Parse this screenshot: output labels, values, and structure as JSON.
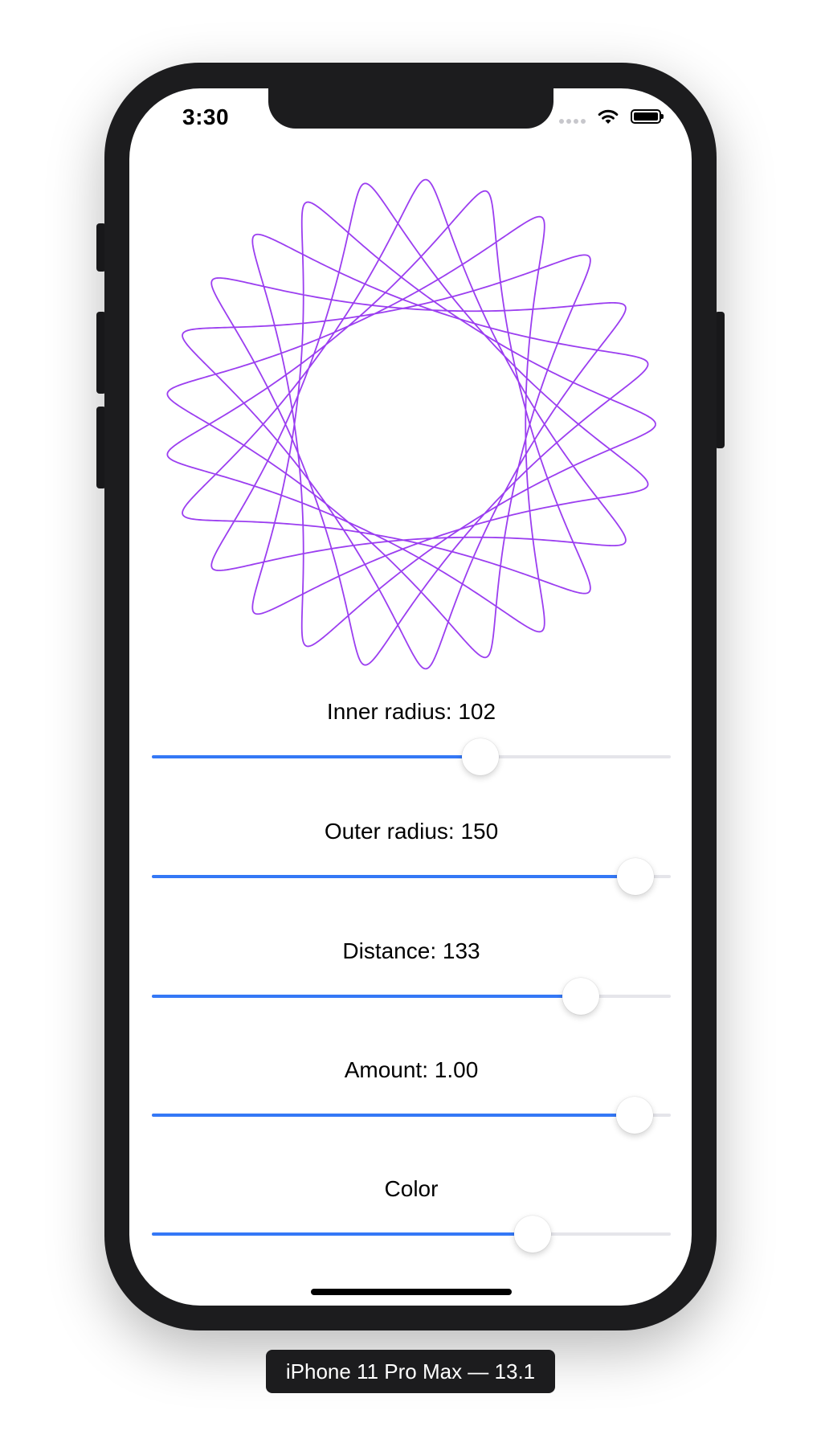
{
  "status_bar": {
    "time": "3:30"
  },
  "spirograph": {
    "inner_radius": 102,
    "outer_radius": 150,
    "distance": 133,
    "stroke_color": "#9b3ef0"
  },
  "controls": [
    {
      "label": "Inner radius: 102",
      "value": 0.643
    },
    {
      "label": "Outer radius: 150",
      "value": 0.965
    },
    {
      "label": "Distance: 133",
      "value": 0.852
    },
    {
      "label": "Amount: 1.00",
      "value": 0.963
    },
    {
      "label": "Color",
      "value": 0.751
    }
  ],
  "colors": {
    "accent": "#3478f6",
    "track": "#e5e5ea",
    "frame": "#1c1c1e"
  },
  "device_label": "iPhone 11 Pro Max — 13.1"
}
